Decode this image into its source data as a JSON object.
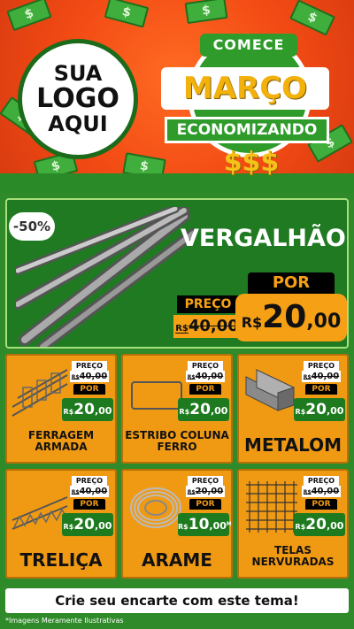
{
  "header": {
    "logo": {
      "line1": "SUA",
      "line2": "LOGO",
      "line3": "AQUI"
    },
    "badge": {
      "top": "COMECE",
      "middle": "MARÇO",
      "bottom": "ECONOMIZANDO",
      "symbol": "$$$"
    },
    "bill_symbol": "$"
  },
  "hero": {
    "discount": "-50%",
    "title": "VERGALHÃO",
    "por_label": "POR",
    "preco_label": "PREÇO",
    "old_price": {
      "currency": "R$",
      "value": "40,00"
    },
    "new_price": {
      "currency": "R$",
      "int": "20",
      "dec": ",00"
    }
  },
  "products": [
    {
      "name": "FERRAGEM ARMADA",
      "preco_label": "PREÇO",
      "por_label": "POR",
      "old_currency": "R$",
      "old_value": "40,00",
      "cur": "R$",
      "int": "20",
      "dec": ",00",
      "unit": "",
      "icon": "rebar-cage-icon"
    },
    {
      "name": "ESTRIBO COLUNA FERRO",
      "preco_label": "PREÇO",
      "por_label": "POR",
      "old_currency": "R$",
      "old_value": "40,00",
      "cur": "R$",
      "int": "20",
      "dec": ",00",
      "unit": "",
      "icon": "stirrup-icon"
    },
    {
      "name": "METALOM",
      "preco_label": "PREÇO",
      "por_label": "POR",
      "old_currency": "R$",
      "old_value": "40,00",
      "cur": "R$",
      "int": "20",
      "dec": ",00",
      "unit": "",
      "icon": "metal-tube-icon"
    },
    {
      "name": "TRELIÇA",
      "preco_label": "PREÇO",
      "por_label": "POR",
      "old_currency": "R$",
      "old_value": "40,00",
      "cur": "R$",
      "int": "20",
      "dec": ",00",
      "unit": "",
      "icon": "truss-icon"
    },
    {
      "name": "ARAME",
      "preco_label": "PREÇO",
      "por_label": "POR",
      "old_currency": "R$",
      "old_value": "20,00",
      "cur": "R$",
      "int": "10",
      "dec": ",00",
      "unit": "MT",
      "icon": "wire-coil-icon"
    },
    {
      "name": "TELAS NERVURADAS",
      "preco_label": "PREÇO",
      "por_label": "POR",
      "old_currency": "R$",
      "old_value": "40,00",
      "cur": "R$",
      "int": "20",
      "dec": ",00",
      "unit": "",
      "icon": "mesh-icon"
    }
  ],
  "cta": "Crie seu encarte com este tema!",
  "footer": "*Imagens Meramente Ilustrativas",
  "colors": {
    "orange": "#f09a14",
    "green": "#1f7a22",
    "header": "#f24a14"
  }
}
